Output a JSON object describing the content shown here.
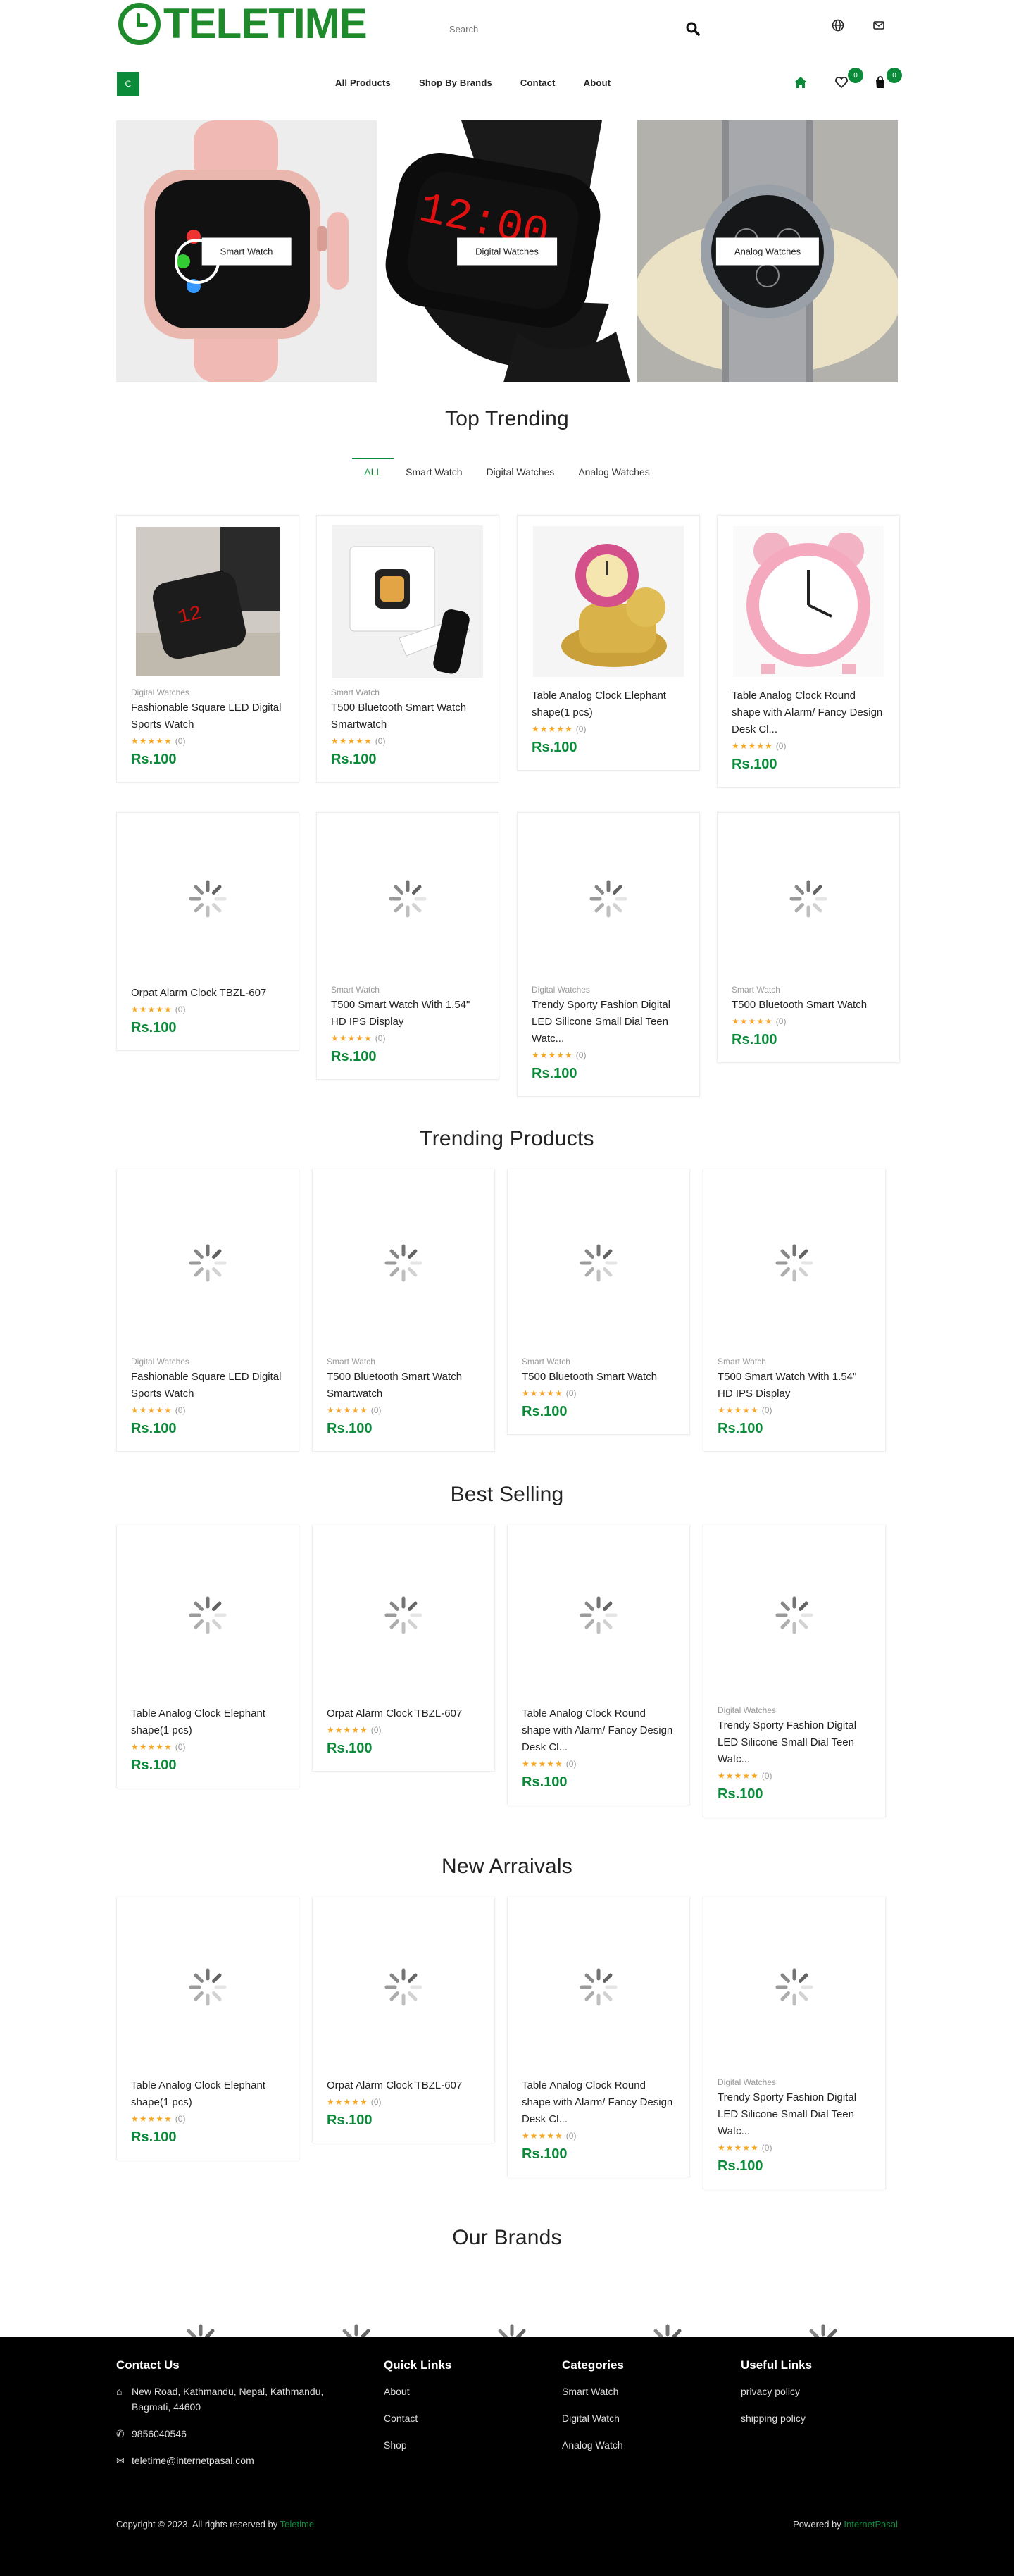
{
  "header": {
    "logo_text": "TELETIME",
    "search_placeholder": "Search",
    "icons": [
      "search-icon",
      "globe-icon",
      "mail-icon"
    ]
  },
  "nav": {
    "category_button": "C",
    "links": [
      "All Products",
      "Shop By Brands",
      "Contact",
      "About"
    ],
    "wishlist_count": "0",
    "cart_count": "0"
  },
  "banners": [
    "Smart Watch",
    "Digital Watches",
    "Analog Watches"
  ],
  "top_trending": {
    "title": "Top Trending",
    "tabs": [
      "ALL",
      "Smart Watch",
      "Digital Watches",
      "Analog Watches"
    ],
    "row1": [
      {
        "category": "Digital Watches",
        "name": "Fashionable Square LED Digital Sports Watch",
        "reviews": "(0)",
        "price": "Rs.100"
      },
      {
        "category": "Smart Watch",
        "name": "T500 Bluetooth Smart Watch Smartwatch",
        "reviews": "(0)",
        "price": "Rs.100"
      },
      {
        "category": "",
        "name": "Table Analog Clock Elephant shape(1 pcs)",
        "reviews": "(0)",
        "price": "Rs.100"
      },
      {
        "category": "",
        "name": "Table Analog Clock Round shape with Alarm/ Fancy Design Desk Cl...",
        "reviews": "(0)",
        "price": "Rs.100"
      }
    ],
    "row2": [
      {
        "category": "",
        "name": "Orpat Alarm Clock TBZL-607",
        "reviews": "(0)",
        "price": "Rs.100"
      },
      {
        "category": "Smart Watch",
        "name": "T500 Smart Watch With 1.54\" HD IPS Display",
        "reviews": "(0)",
        "price": "Rs.100"
      },
      {
        "category": "Digital Watches",
        "name": "Trendy Sporty Fashion Digital LED Silicone Small Dial Teen Watc...",
        "reviews": "(0)",
        "price": "Rs.100"
      },
      {
        "category": "Smart Watch",
        "name": "T500 Bluetooth Smart Watch",
        "reviews": "(0)",
        "price": "Rs.100"
      }
    ]
  },
  "trending_products": {
    "title": "Trending Products",
    "items": [
      {
        "category": "Digital Watches",
        "name": "Fashionable Square LED Digital Sports Watch",
        "reviews": "(0)",
        "price": "Rs.100"
      },
      {
        "category": "Smart Watch",
        "name": "T500 Bluetooth Smart Watch Smartwatch",
        "reviews": "(0)",
        "price": "Rs.100"
      },
      {
        "category": "Smart Watch",
        "name": "T500 Bluetooth Smart Watch",
        "reviews": "(0)",
        "price": "Rs.100"
      },
      {
        "category": "Smart Watch",
        "name": "T500 Smart Watch With 1.54\" HD IPS Display",
        "reviews": "(0)",
        "price": "Rs.100"
      }
    ]
  },
  "best_selling": {
    "title": "Best Selling",
    "items": [
      {
        "category": "",
        "name": "Table Analog Clock Elephant shape(1 pcs)",
        "reviews": "(0)",
        "price": "Rs.100"
      },
      {
        "category": "",
        "name": "Orpat Alarm Clock TBZL-607",
        "reviews": "(0)",
        "price": "Rs.100"
      },
      {
        "category": "",
        "name": "Table Analog Clock Round shape with Alarm/ Fancy Design Desk Cl...",
        "reviews": "(0)",
        "price": "Rs.100"
      },
      {
        "category": "Digital Watches",
        "name": "Trendy Sporty Fashion Digital LED Silicone Small Dial Teen Watc...",
        "reviews": "(0)",
        "price": "Rs.100"
      }
    ]
  },
  "new_arrivals": {
    "title": "New Arraivals",
    "items": [
      {
        "category": "",
        "name": "Table Analog Clock Elephant shape(1 pcs)",
        "reviews": "(0)",
        "price": "Rs.100"
      },
      {
        "category": "",
        "name": "Orpat Alarm Clock TBZL-607",
        "reviews": "(0)",
        "price": "Rs.100"
      },
      {
        "category": "",
        "name": "Table Analog Clock Round shape with Alarm/ Fancy Design Desk Cl...",
        "reviews": "(0)",
        "price": "Rs.100"
      },
      {
        "category": "Digital Watches",
        "name": "Trendy Sporty Fashion Digital LED Silicone Small Dial Teen Watc...",
        "reviews": "(0)",
        "price": "Rs.100"
      }
    ]
  },
  "brands": {
    "title": "Our Brands"
  },
  "footer": {
    "contact": {
      "title": "Contact Us",
      "address": "New Road, Kathmandu, Nepal, Kathmandu, Bagmati, 44600",
      "phone": "9856040546",
      "email": "teletime@internetpasal.com"
    },
    "quick_links": {
      "title": "Quick Links",
      "items": [
        "About",
        "Contact",
        "Shop"
      ]
    },
    "categories": {
      "title": "Categories",
      "items": [
        "Smart Watch",
        "Digital Watch",
        "Analog Watch"
      ]
    },
    "useful_links": {
      "title": "Useful Links",
      "items": [
        "privacy policy",
        "shipping policy"
      ]
    },
    "copyright": "Copyright © 2023. All rights reserved by",
    "copyright_brand": "Teletime",
    "powered_by": "Powered by",
    "powered_brand": "InternetPasal"
  },
  "colors": {
    "brand_green": "#0b8a3a",
    "logo_green": "#1e8a2c",
    "star": "#f5a623",
    "footer_bg": "#000000"
  }
}
